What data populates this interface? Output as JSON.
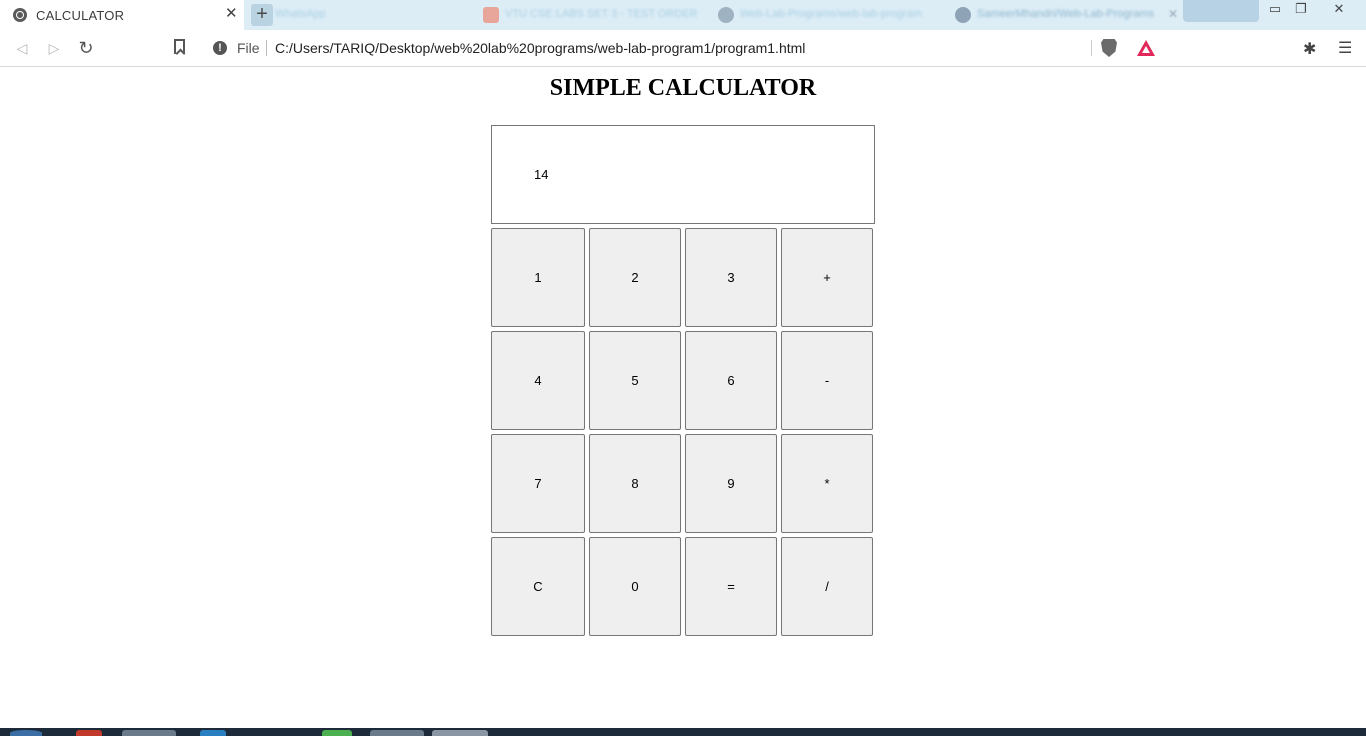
{
  "browser": {
    "active_tab_title": "CALCULATOR",
    "background_tabs": [
      {
        "label": "WhatsApp",
        "icon_color": "#bcd9ea"
      },
      {
        "label": "VTU CSE LABS SET 3 - TEST ORDER",
        "icon_color": "#e8a59a"
      },
      {
        "label": "Web-Lab-Programs/web-lab-program",
        "icon_color": "#9fb2c2"
      },
      {
        "label": "SameerMhandri/Web-Lab-Programs",
        "icon_color": "#8ea3b5"
      }
    ],
    "address": {
      "scheme": "File",
      "url": "C:/Users/TARIQ/Desktop/web%20lab%20programs/web-lab-program1/program1.html"
    }
  },
  "page": {
    "title": "SIMPLE CALCULATOR",
    "display_value": "14",
    "keys": [
      [
        "1",
        "2",
        "3",
        "+"
      ],
      [
        "4",
        "5",
        "6",
        "-"
      ],
      [
        "7",
        "8",
        "9",
        "*"
      ],
      [
        "C",
        "0",
        "=",
        "/"
      ]
    ]
  },
  "colors": {
    "tabstrip_bg": "#dcedf6",
    "button_face": "#efefef",
    "button_border": "#767676",
    "rewards_accent": "#e2285a"
  }
}
